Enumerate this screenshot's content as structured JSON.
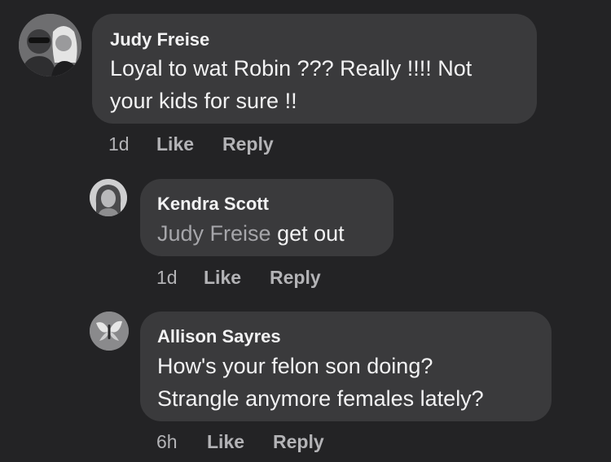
{
  "comments": [
    {
      "author": "Judy Freise",
      "lines": [
        "Loyal to wat Robin ??? Really !!!! Not",
        "your kids for sure !!"
      ],
      "time": "1d",
      "like_label": "Like",
      "reply_label": "Reply"
    },
    {
      "author": "Kendra Scott",
      "mention": "Judy Freise",
      "text": " get out",
      "time": "1d",
      "like_label": "Like",
      "reply_label": "Reply"
    },
    {
      "author": "Allison Sayres",
      "lines": [
        "How's your felon son doing?",
        "Strangle anymore females lately?"
      ],
      "time": "6h",
      "like_label": "Like",
      "reply_label": "Reply"
    }
  ]
}
